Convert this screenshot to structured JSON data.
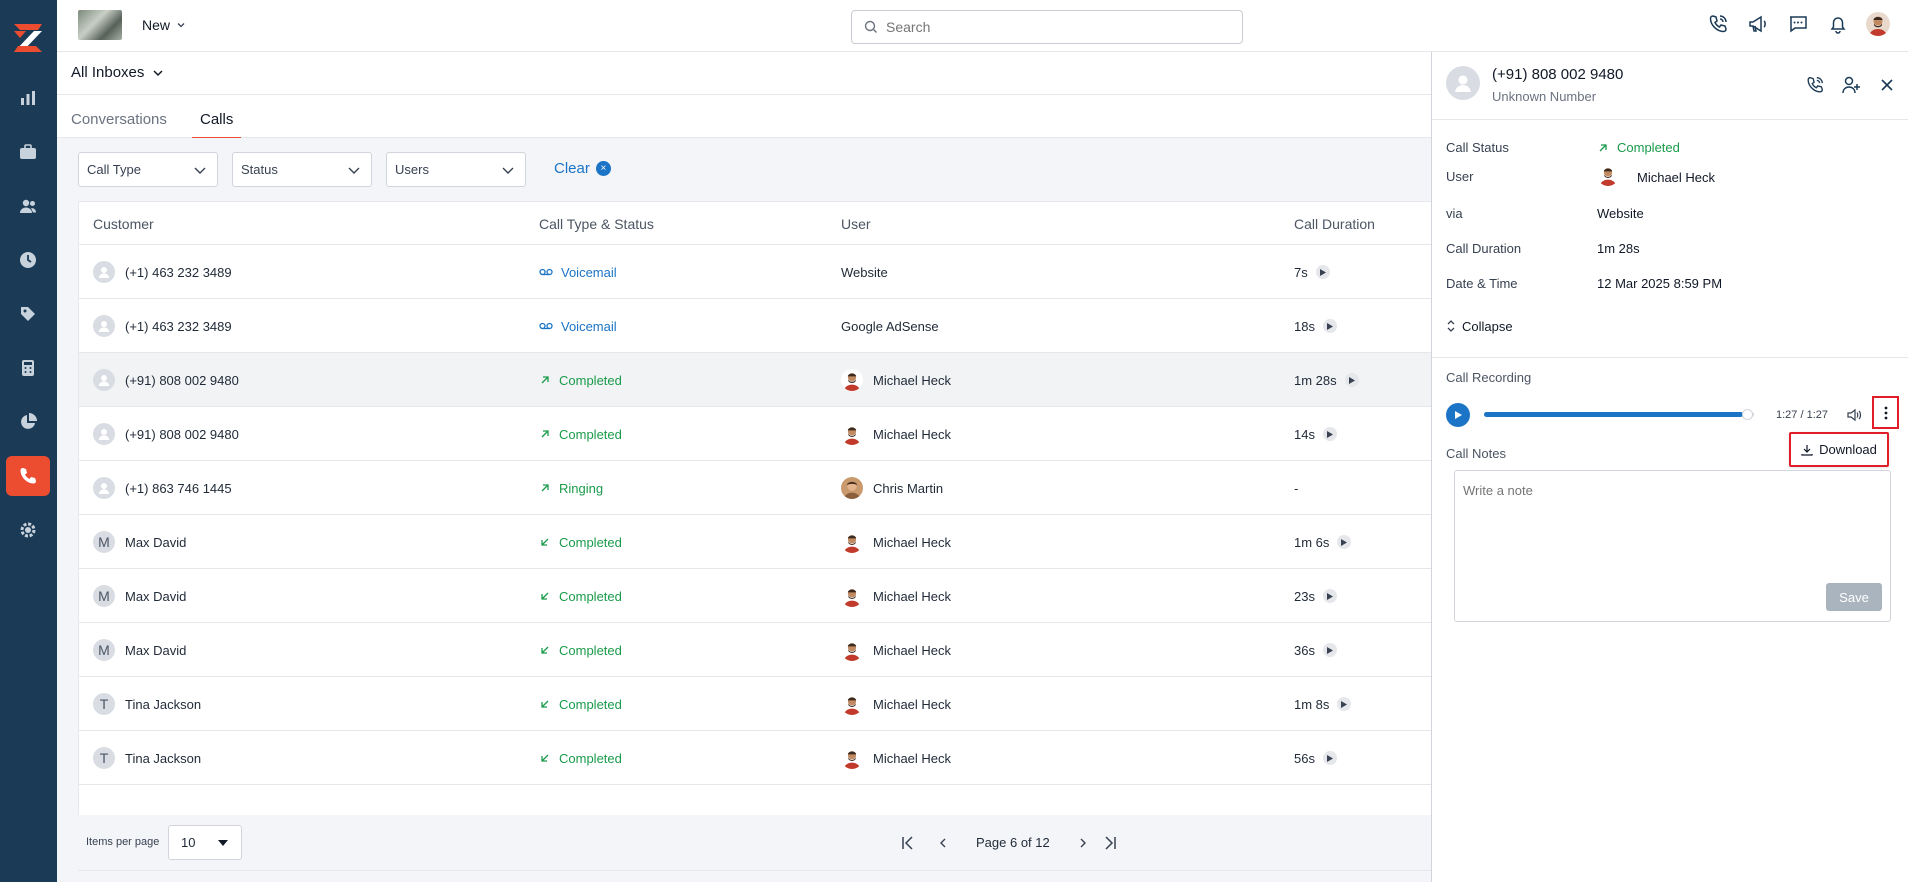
{
  "header": {
    "new_label": "New",
    "search_placeholder": "Search"
  },
  "inbox": {
    "label": "All Inboxes"
  },
  "tabs": [
    {
      "label": "Conversations",
      "active": false
    },
    {
      "label": "Calls",
      "active": true
    }
  ],
  "filters": {
    "call_type": "Call Type",
    "status": "Status",
    "users": "Users",
    "clear": "Clear"
  },
  "table": {
    "columns": [
      "Customer",
      "Call Type & Status",
      "User",
      "Call Duration"
    ],
    "rows": [
      {
        "customer": "(+1) 463 232 3489",
        "avatar": "",
        "status": "Voicemail",
        "status_kind": "voicemail",
        "user": "Website",
        "user_avatar": "",
        "duration": "7s"
      },
      {
        "customer": "(+1) 463 232 3489",
        "avatar": "",
        "status": "Voicemail",
        "status_kind": "voicemail",
        "user": "Google AdSense",
        "user_avatar": "",
        "duration": "18s"
      },
      {
        "customer": "(+91) 808 002 9480",
        "avatar": "",
        "status": "Completed",
        "status_kind": "outgoing",
        "user": "Michael Heck",
        "user_avatar": "mh",
        "duration": "1m 28s"
      },
      {
        "customer": "(+91) 808 002 9480",
        "avatar": "",
        "status": "Completed",
        "status_kind": "outgoing",
        "user": "Michael Heck",
        "user_avatar": "mh",
        "duration": "14s"
      },
      {
        "customer": "(+1) 863 746 1445",
        "avatar": "",
        "status": "Ringing",
        "status_kind": "outgoing",
        "user": "Chris Martin",
        "user_avatar": "cm",
        "duration": "-"
      },
      {
        "customer": "Max David",
        "avatar": "M",
        "status": "Completed",
        "status_kind": "incoming",
        "user": "Michael Heck",
        "user_avatar": "mh",
        "duration": "1m 6s"
      },
      {
        "customer": "Max David",
        "avatar": "M",
        "status": "Completed",
        "status_kind": "incoming",
        "user": "Michael Heck",
        "user_avatar": "mh",
        "duration": "23s"
      },
      {
        "customer": "Max David",
        "avatar": "M",
        "status": "Completed",
        "status_kind": "incoming",
        "user": "Michael Heck",
        "user_avatar": "mh",
        "duration": "36s"
      },
      {
        "customer": "Tina Jackson",
        "avatar": "T",
        "status": "Completed",
        "status_kind": "incoming",
        "user": "Michael Heck",
        "user_avatar": "mh",
        "duration": "1m 8s"
      },
      {
        "customer": "Tina Jackson",
        "avatar": "T",
        "status": "Completed",
        "status_kind": "incoming",
        "user": "Michael Heck",
        "user_avatar": "mh",
        "duration": "56s"
      }
    ]
  },
  "pagination": {
    "items_per_page_label": "Items per page",
    "items_per_page": "10",
    "page_text": "Page 6 of 12"
  },
  "panel": {
    "number": "(+91) 808 002 9480",
    "subtitle": "Unknown Number",
    "details": [
      {
        "label": "Call Status",
        "value": "Completed"
      },
      {
        "label": "User",
        "value": "Michael Heck"
      },
      {
        "label": "via",
        "value": "Website"
      },
      {
        "label": "Call Duration",
        "value": "1m 28s"
      },
      {
        "label": "Date & Time",
        "value": "12 Mar 2025 8:59 PM"
      }
    ],
    "collapse_label": "Collapse",
    "recording_label": "Call Recording",
    "time": "1:27 / 1:27",
    "progress": 0.96,
    "download_label": "Download",
    "notes_label": "Call Notes",
    "notes_placeholder": "Write a note",
    "save_label": "Save"
  },
  "colors": {
    "sidebar": "#1b3a56",
    "accent": "#ec4c2f",
    "link_blue": "#1b74c5",
    "success_green": "#1a9b4b",
    "highlight_red": "#e11d2a"
  }
}
